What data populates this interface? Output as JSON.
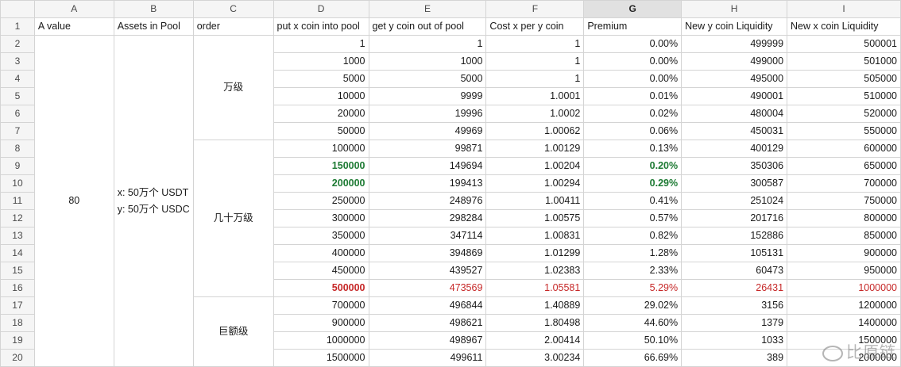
{
  "columns": [
    "A",
    "B",
    "C",
    "D",
    "E",
    "F",
    "G",
    "H",
    "I"
  ],
  "row_numbers": [
    "1",
    "2",
    "3",
    "4",
    "5",
    "6",
    "7",
    "8",
    "9",
    "10",
    "11",
    "12",
    "13",
    "14",
    "15",
    "16",
    "17",
    "18",
    "19",
    "20"
  ],
  "headers": {
    "a": "A value",
    "b": "Assets in Pool",
    "c": "order",
    "d": "put x coin into pool",
    "e": "get y coin out of pool",
    "f": "Cost x per y coin",
    "g": "Premium",
    "h": "New y coin Liquidity",
    "i": "New x coin Liquidity"
  },
  "a_value": "80",
  "assets": {
    "line1": "x: 50万个 USDT",
    "line2": "y: 50万个 USDC"
  },
  "orders": {
    "g1": "万级",
    "g2": "几十万级",
    "g3": "巨额级"
  },
  "rows": [
    {
      "d": "1",
      "e": "1",
      "f": "1",
      "g": "0.00%",
      "h": "499999",
      "i": "500001"
    },
    {
      "d": "1000",
      "e": "1000",
      "f": "1",
      "g": "0.00%",
      "h": "499000",
      "i": "501000"
    },
    {
      "d": "5000",
      "e": "5000",
      "f": "1",
      "g": "0.00%",
      "h": "495000",
      "i": "505000"
    },
    {
      "d": "10000",
      "e": "9999",
      "f": "1.0001",
      "g": "0.01%",
      "h": "490001",
      "i": "510000"
    },
    {
      "d": "20000",
      "e": "19996",
      "f": "1.0002",
      "g": "0.02%",
      "h": "480004",
      "i": "520000"
    },
    {
      "d": "50000",
      "e": "49969",
      "f": "1.00062",
      "g": "0.06%",
      "h": "450031",
      "i": "550000"
    },
    {
      "d": "100000",
      "e": "99871",
      "f": "1.00129",
      "g": "0.13%",
      "h": "400129",
      "i": "600000"
    },
    {
      "d": "150000",
      "e": "149694",
      "f": "1.00204",
      "g": "0.20%",
      "h": "350306",
      "i": "650000"
    },
    {
      "d": "200000",
      "e": "199413",
      "f": "1.00294",
      "g": "0.29%",
      "h": "300587",
      "i": "700000"
    },
    {
      "d": "250000",
      "e": "248976",
      "f": "1.00411",
      "g": "0.41%",
      "h": "251024",
      "i": "750000"
    },
    {
      "d": "300000",
      "e": "298284",
      "f": "1.00575",
      "g": "0.57%",
      "h": "201716",
      "i": "800000"
    },
    {
      "d": "350000",
      "e": "347114",
      "f": "1.00831",
      "g": "0.82%",
      "h": "152886",
      "i": "850000"
    },
    {
      "d": "400000",
      "e": "394869",
      "f": "1.01299",
      "g": "1.28%",
      "h": "105131",
      "i": "900000"
    },
    {
      "d": "450000",
      "e": "439527",
      "f": "1.02383",
      "g": "2.33%",
      "h": "60473",
      "i": "950000"
    },
    {
      "d": "500000",
      "e": "473569",
      "f": "1.05581",
      "g": "5.29%",
      "h": "26431",
      "i": "1000000"
    },
    {
      "d": "700000",
      "e": "496844",
      "f": "1.40889",
      "g": "29.02%",
      "h": "3156",
      "i": "1200000"
    },
    {
      "d": "900000",
      "e": "498621",
      "f": "1.80498",
      "g": "44.60%",
      "h": "1379",
      "i": "1400000"
    },
    {
      "d": "1000000",
      "e": "498967",
      "f": "2.00414",
      "g": "50.10%",
      "h": "1033",
      "i": "1500000"
    },
    {
      "d": "1500000",
      "e": "499611",
      "f": "3.00234",
      "g": "66.69%",
      "h": "389",
      "i": "2000000"
    }
  ],
  "highlight_colors": {
    "green": "#1e7b34",
    "red": "#c62828"
  },
  "watermark": "比原链",
  "watermark_icon": "weibo-logo"
}
